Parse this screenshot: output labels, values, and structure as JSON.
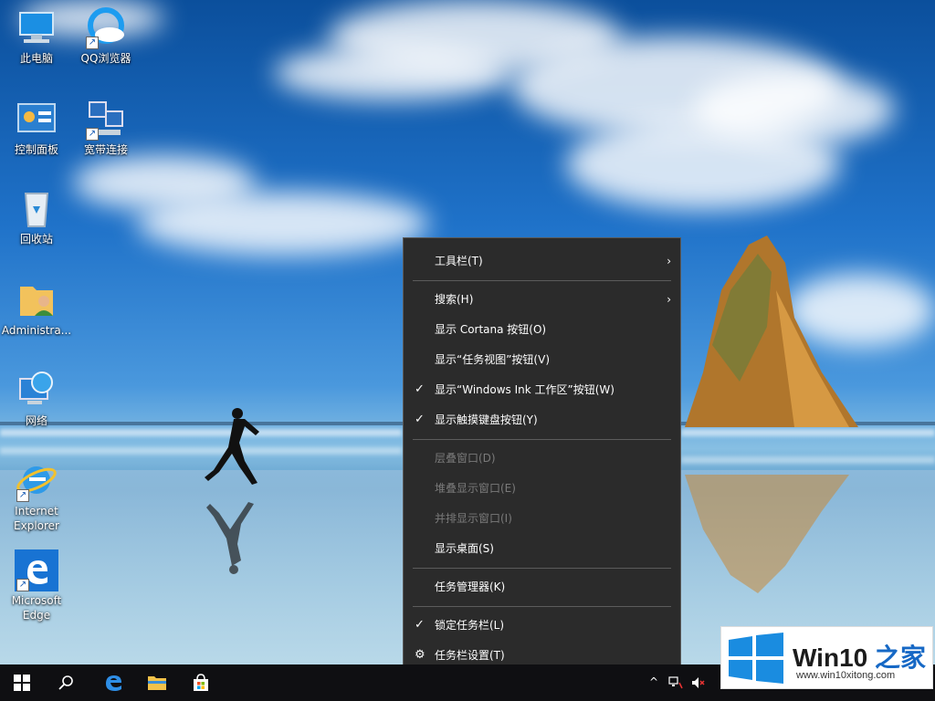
{
  "desktop": {
    "icons": [
      {
        "label": "此电脑"
      },
      {
        "label": "QQ浏览器"
      },
      {
        "label": "控制面板"
      },
      {
        "label": "宽带连接"
      },
      {
        "label": "回收站"
      },
      {
        "label": "Administra..."
      },
      {
        "label": "网络"
      },
      {
        "label": "Internet Explorer"
      },
      {
        "label": "Microsoft Edge"
      }
    ]
  },
  "context_menu": {
    "items": [
      {
        "label": "工具栏(T)",
        "arrow": "›"
      },
      {
        "label": "搜索(H)",
        "arrow": "›"
      },
      {
        "label": "显示 Cortana 按钮(O)"
      },
      {
        "label": "显示“任务视图”按钮(V)"
      },
      {
        "label": "显示“Windows Ink 工作区”按钮(W)",
        "check": "✓"
      },
      {
        "label": "显示触摸键盘按钮(Y)",
        "check": "✓"
      },
      {
        "label": "层叠窗口(D)"
      },
      {
        "label": "堆叠显示窗口(E)"
      },
      {
        "label": "并排显示窗口(I)"
      },
      {
        "label": "显示桌面(S)"
      },
      {
        "label": "任务管理器(K)"
      },
      {
        "label": "锁定任务栏(L)",
        "check": "✓"
      },
      {
        "label": "任务栏设置(T)",
        "icon": "⚙"
      }
    ]
  },
  "taskbar": {
    "tray": {
      "chevron": "^"
    }
  },
  "watermark": {
    "brand": "Win10",
    "brand_cn": "之家",
    "url": "www.win10xitong.com"
  },
  "colors": {
    "menu_bg": "#2b2b2b",
    "menu_text": "#ffffff",
    "menu_disabled": "#7a7a7a",
    "taskbar_bg": "#0f0f12",
    "accent": "#1668c5"
  }
}
